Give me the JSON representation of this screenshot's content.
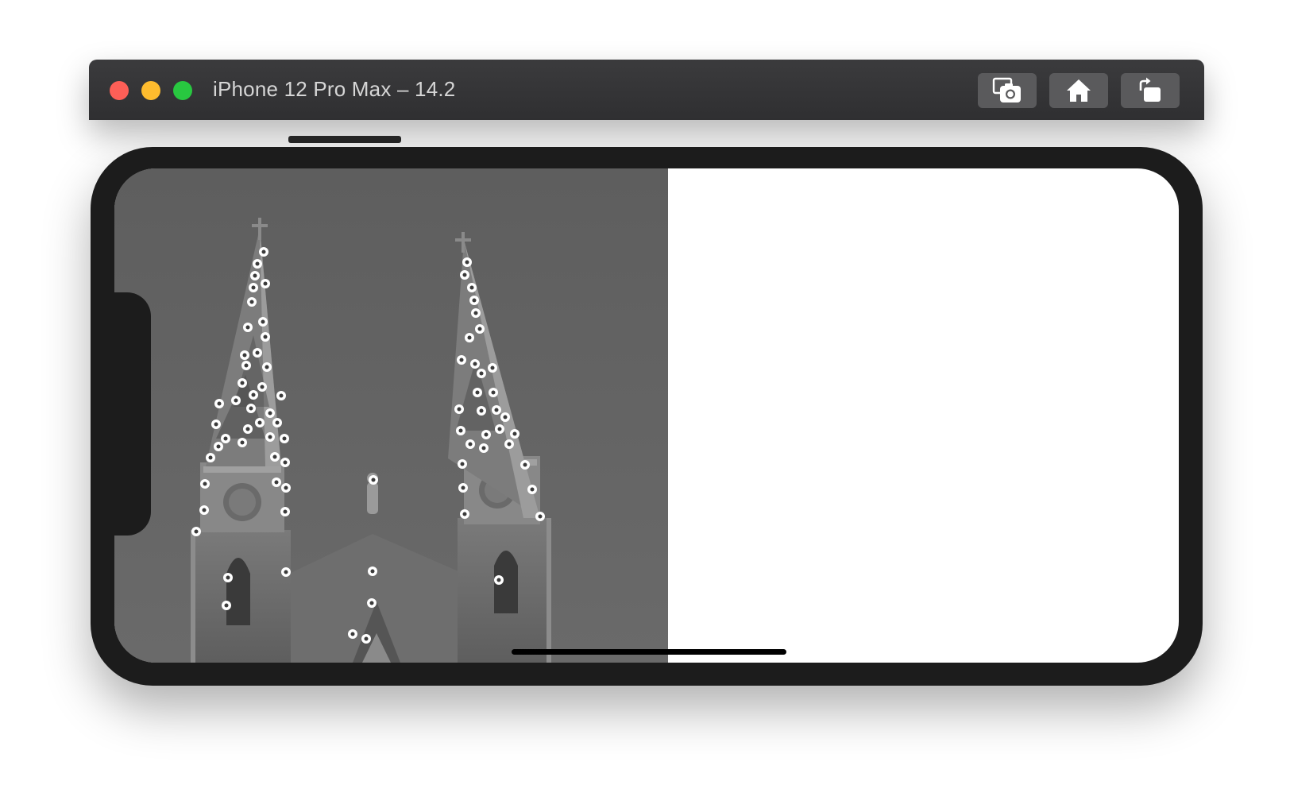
{
  "window": {
    "title": "iPhone 12 Pro Max – 14.2",
    "traffic_lights": {
      "close": "#fe5f57",
      "minimize": "#febc2e",
      "zoom": "#28c840"
    },
    "toolbar_buttons": [
      {
        "id": "screenshot",
        "icon": "camera-screenshot-icon"
      },
      {
        "id": "home",
        "icon": "home-icon"
      },
      {
        "id": "rotate",
        "icon": "rotate-icon"
      }
    ]
  },
  "device": {
    "body_color": "#1c1c1c",
    "screen": {
      "left_pane": {
        "content": "grayscale cathedral photo with white feature-point markers",
        "background": "#5b5b5b"
      },
      "right_pane": {
        "background": "#ffffff"
      }
    }
  }
}
